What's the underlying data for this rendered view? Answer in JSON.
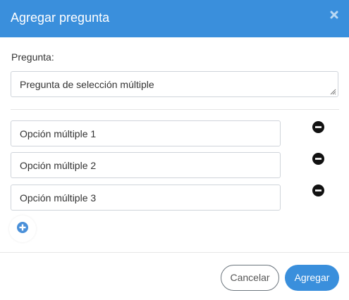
{
  "dialog": {
    "title": "Agregar pregunta",
    "accent_color": "#3a8fdc",
    "close_icon": "close-icon"
  },
  "question": {
    "label": "Pregunta:",
    "value": "Pregunta de selección múltiple"
  },
  "options": [
    {
      "value": "Opción múltiple 1",
      "remove_icon": "minus-circle-icon"
    },
    {
      "value": "Opción múltiple 2",
      "remove_icon": "minus-circle-icon"
    },
    {
      "value": "Opción múltiple 3",
      "remove_icon": "minus-circle-icon"
    }
  ],
  "add_option": {
    "icon": "plus-circle-icon"
  },
  "footer": {
    "cancel_label": "Cancelar",
    "submit_label": "Agregar"
  }
}
